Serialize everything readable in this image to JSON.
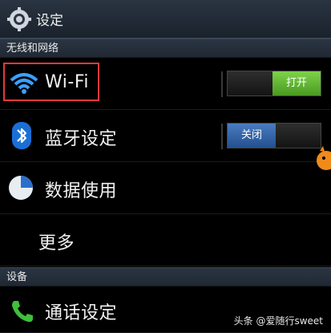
{
  "header": {
    "title": "设定",
    "icon": "gear-icon"
  },
  "sections": {
    "wireless": "无线和网络",
    "device": "设备"
  },
  "items": {
    "wifi": {
      "label": "Wi-Fi",
      "toggle": "打开",
      "icon": "wifi-icon"
    },
    "bluetooth": {
      "label": "蓝牙设定",
      "toggle": "关闭",
      "icon": "bluetooth-icon"
    },
    "data": {
      "label": "数据使用",
      "icon": "pie-chart-icon"
    },
    "more": {
      "label": "更多"
    },
    "call": {
      "label": "通话设定",
      "icon": "phone-icon"
    }
  },
  "watermark": "头条 @爱随行sweet",
  "colors": {
    "toggle_on": "#5aad2c",
    "toggle_off": "#2e5f9f",
    "highlight": "#e23a3a"
  }
}
